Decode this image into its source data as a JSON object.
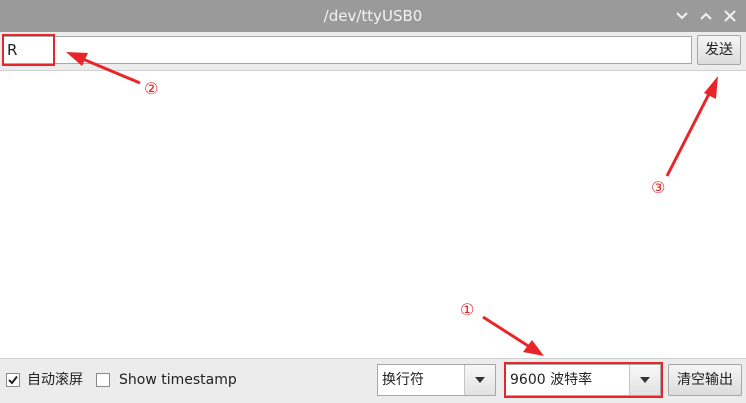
{
  "window": {
    "title": "/dev/ttyUSB0",
    "icons": [
      "minimize-chevron-icon",
      "maximize-chevron-icon",
      "close-icon"
    ]
  },
  "send_row": {
    "input_value": "R",
    "send_label": "发送"
  },
  "output": {
    "text": ""
  },
  "bottom_bar": {
    "autoscroll": {
      "label": "自动滚屏",
      "checked": true
    },
    "timestamp": {
      "label": "Show timestamp",
      "checked": false
    },
    "line_ending": {
      "value": "换行符"
    },
    "baud_rate": {
      "value": "9600 波特率"
    },
    "clear_label": "清空输出"
  },
  "annotations": {
    "markers": [
      "①",
      "②",
      "③"
    ],
    "color": "#e8262a"
  },
  "colors": {
    "titlebar": "#9a9a9a",
    "toolbar": "#ececec",
    "highlight": "#e8262a"
  }
}
